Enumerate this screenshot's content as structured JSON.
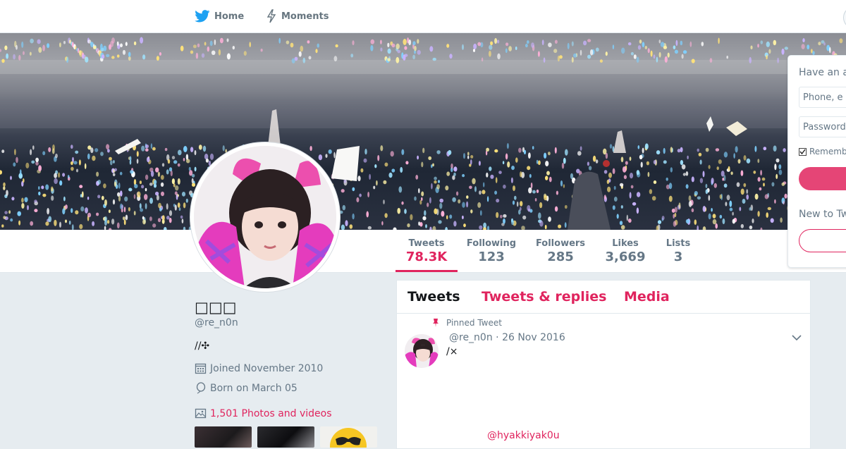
{
  "nav": {
    "home_label": "Home",
    "moments_label": "Moments"
  },
  "stats": [
    {
      "label": "Tweets",
      "value": "78.3K"
    },
    {
      "label": "Following",
      "value": "123"
    },
    {
      "label": "Followers",
      "value": "285"
    },
    {
      "label": "Likes",
      "value": "3,669"
    },
    {
      "label": "Lists",
      "value": "3"
    }
  ],
  "profile": {
    "name": "□□□",
    "handle": "@re_n0n",
    "bio": "//✣",
    "joined": "Joined November 2010",
    "born": "Born on March 05",
    "photos": "1,501 Photos and videos"
  },
  "tabs": {
    "tweets": "Tweets",
    "replies": "Tweets & replies",
    "media": "Media"
  },
  "tweet": {
    "pinned_label": "Pinned Tweet",
    "header": "@re_n0n · 26 Nov 2016",
    "text": "/×",
    "mention": "@hyakkiyak0u"
  },
  "login": {
    "title": "Have an a",
    "phone_placeholder": "Phone, e",
    "password_placeholder": "Password",
    "remember": "Rememb",
    "new_label": "New to Tw"
  },
  "colors": {
    "accent": "#e0245e",
    "muted": "#657786",
    "background": "#e6ecf0"
  }
}
